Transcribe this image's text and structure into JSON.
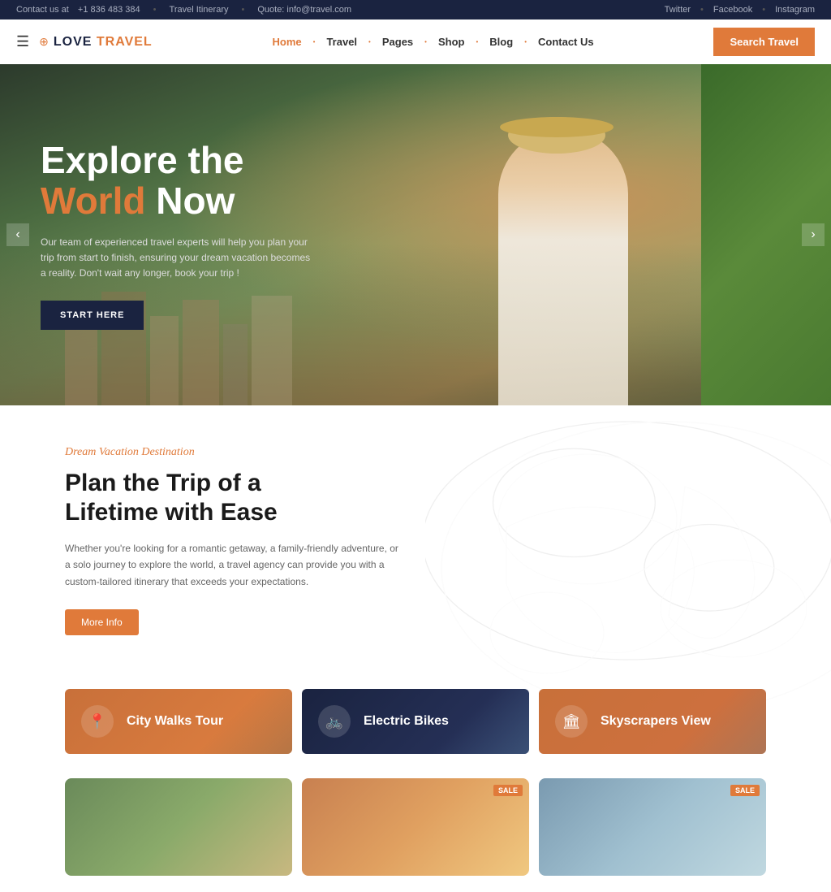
{
  "topbar": {
    "contact_label": "Contact us at",
    "contact_phone": "+1 836 483 384",
    "itinerary_label": "Travel Itinerary",
    "quote_label": "Quote: info@travel.com",
    "social": [
      "Twitter",
      "Facebook",
      "Instagram"
    ]
  },
  "header": {
    "logo_text_1": "Love",
    "logo_text_2": "Travel",
    "nav_items": [
      {
        "label": "Home",
        "active": true
      },
      {
        "label": "Travel",
        "active": false
      },
      {
        "label": "Pages",
        "active": false
      },
      {
        "label": "Shop",
        "active": false
      },
      {
        "label": "Blog",
        "active": false
      },
      {
        "label": "Contact Us",
        "active": false
      }
    ],
    "search_btn": "Search Travel"
  },
  "hero": {
    "title_line1": "Explore the",
    "title_highlight": "World",
    "title_line2": "Now",
    "subtitle": "Our team of experienced travel experts will help you plan your trip from start to finish, ensuring your dream vacation becomes a reality. Don't wait any longer, book your trip !",
    "cta_btn": "START HERE",
    "arrow_left": "‹",
    "arrow_right": "›"
  },
  "section": {
    "label": "Dream Vacation Destination",
    "title": "Plan the Trip of a Lifetime with Ease",
    "desc": "Whether you're looking for a romantic getaway, a family-friendly adventure, or a solo journey to explore the world, a travel agency can provide you with a custom-tailored itinerary that exceeds your expectations.",
    "more_info_btn": "More Info"
  },
  "tour_cards": [
    {
      "label": "City Walks Tour",
      "icon": "📍",
      "id": 1
    },
    {
      "label": "Electric Bikes",
      "icon": "🚲",
      "id": 2
    },
    {
      "label": "Skyscrapers View",
      "icon": "🏛",
      "id": 3
    }
  ],
  "bottom_cards": [
    {
      "badge": null,
      "id": 1
    },
    {
      "badge": "SALE",
      "id": 2
    },
    {
      "badge": "SALE",
      "id": 3
    }
  ]
}
